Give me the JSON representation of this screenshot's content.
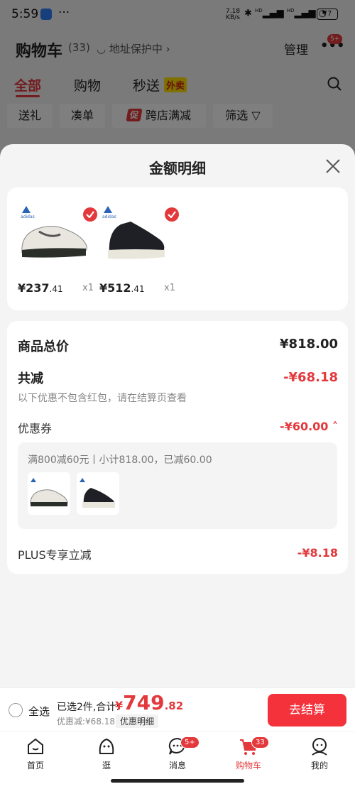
{
  "status_bar": {
    "time": "5:59",
    "more": "···",
    "speed_value": "7.18",
    "speed_unit": "KB/s",
    "signal1": "HD",
    "signal2": "HD",
    "battery": "77"
  },
  "header": {
    "title": "购物车",
    "count": "(33)",
    "address": "地址保护中 ›",
    "manage": "管理",
    "menu_badge": "5+"
  },
  "tabs": [
    {
      "label": "全部"
    },
    {
      "label": "购物"
    },
    {
      "label": "秒送"
    }
  ],
  "tab_tag": "外卖",
  "filter_chips": [
    {
      "label": "送礼"
    },
    {
      "label": "凑单"
    },
    {
      "label": "跨店满减",
      "tag": "促"
    },
    {
      "label": "筛选 ▽"
    }
  ],
  "sheet": {
    "title": "金额明细",
    "brand": "adidas",
    "products": [
      {
        "price_int": "¥237",
        "price_dec": ".41",
        "qty": "x1"
      },
      {
        "price_int": "¥512",
        "price_dec": ".41",
        "qty": "x1"
      }
    ],
    "total_label": "商品总价",
    "total_value": "¥818.00",
    "reduce_label": "共减",
    "reduce_value": "-¥68.18",
    "reduce_note": "以下优惠不包含红包，请在结算页查看",
    "coupon_label": "优惠券",
    "coupon_value": "-¥60.00 ˄",
    "coupon_detail": "满800减60元丨小计818.00，已减60.00",
    "plus_label": "PLUS专享立减",
    "plus_value": "-¥8.18"
  },
  "bottom_bar": {
    "select_all": "全选",
    "selected_info": "已选2件,合计:",
    "total_yen": "¥",
    "total_int": "749",
    "total_dec": ".82",
    "discount_info": "优惠减:¥68.18",
    "detail_button": "优惠明细",
    "checkout": "去结算"
  },
  "nav": [
    {
      "label": "首页"
    },
    {
      "label": "逛"
    },
    {
      "label": "消息",
      "badge": "5+"
    },
    {
      "label": "购物车",
      "badge": "33"
    },
    {
      "label": "我的"
    }
  ],
  "colors": {
    "accent": "#e4393c",
    "checkout": "#f3323c"
  }
}
